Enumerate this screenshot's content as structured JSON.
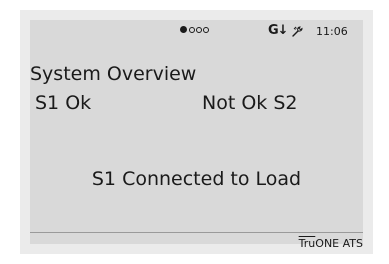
{
  "status_bar": {
    "page_indicator": {
      "active_index": 0,
      "total": 4
    },
    "generator_icon_glyph": "G↓",
    "tool_icon": "wrench-icon",
    "time": "11:06"
  },
  "screen": {
    "title": "System Overview",
    "s1_status": "S1  Ok",
    "s2_status": "Not Ok  S2",
    "message": "S1 Connected to Load"
  },
  "footer": {
    "brand_prefix": "Tru",
    "brand_suffix": "ONE ATS"
  },
  "colors": {
    "screen_background": "#d9d9d9",
    "bezel": "#ebebeb",
    "text": "#1a1a1a"
  }
}
